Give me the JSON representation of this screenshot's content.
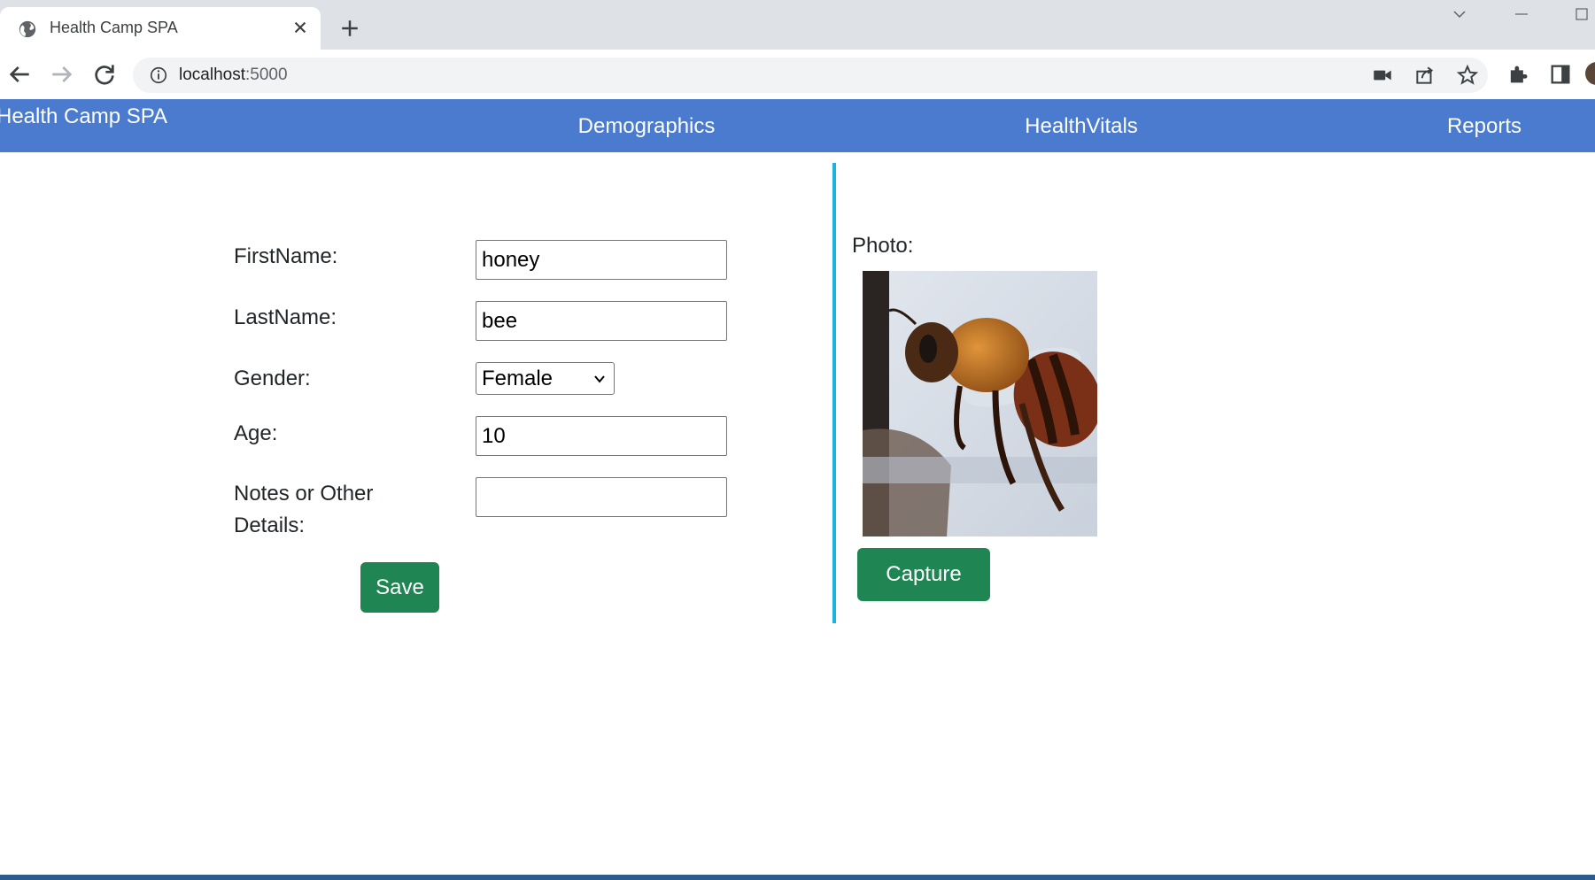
{
  "browser": {
    "tab_title": "Health Camp SPA",
    "url_host": "localhost",
    "url_port": ":5000"
  },
  "app": {
    "brand": "Health Camp SPA",
    "nav": [
      "Demographics",
      "HealthVitals",
      "Reports"
    ]
  },
  "form": {
    "first_name_label": "FirstName:",
    "first_name_value": "honey",
    "last_name_label": "LastName:",
    "last_name_value": "bee",
    "gender_label": "Gender:",
    "gender_value": "Female",
    "age_label": "Age:",
    "age_value": "10",
    "notes_label_line1": "Notes or Other",
    "notes_label_line2": "Details:",
    "notes_value": "",
    "save_label": "Save"
  },
  "photo": {
    "label": "Photo:",
    "capture_label": "Capture"
  },
  "colors": {
    "nav_bg": "#4a7bcf",
    "button_bg": "#1f8553",
    "divider": "#1ab3e0"
  }
}
